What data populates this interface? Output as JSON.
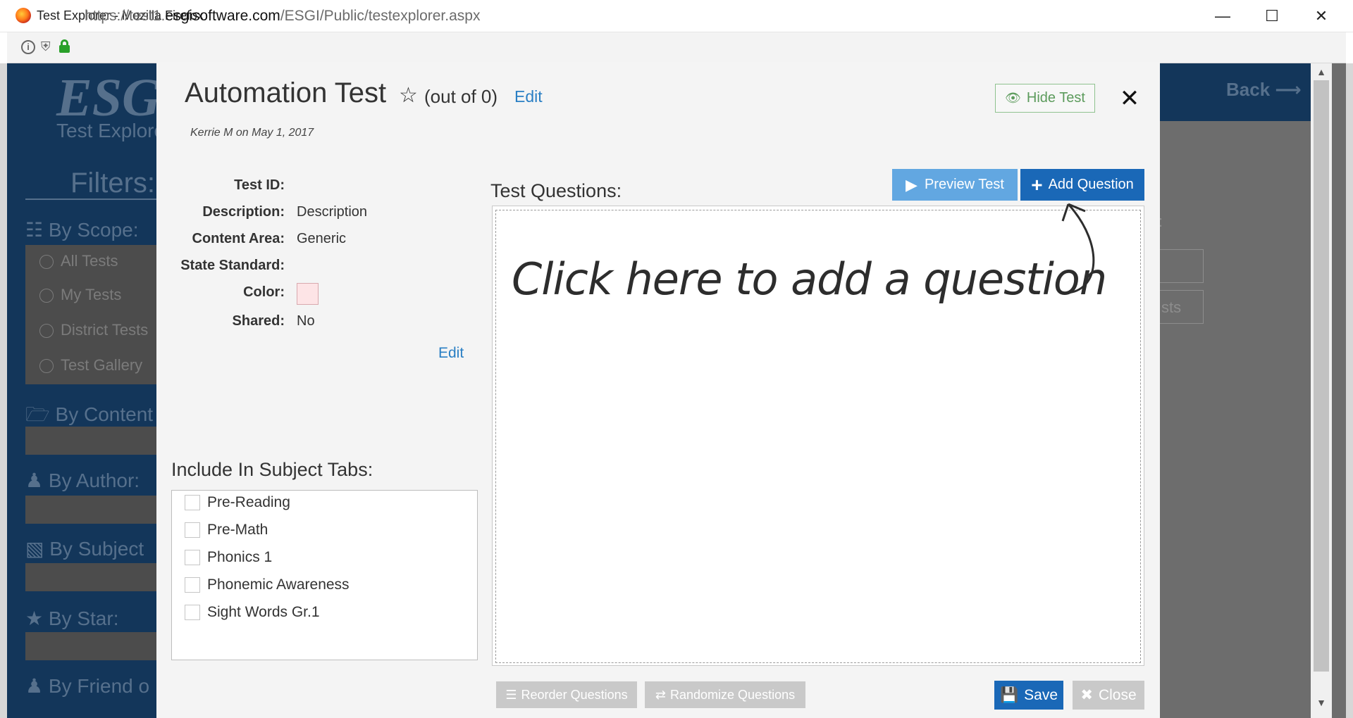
{
  "window": {
    "title": "Test Explorer - Mozilla Firefox",
    "url_prefix": "https://test1.",
    "url_domain": "esgisoftware.com",
    "url_path": "/ESGI/Public/testexplorer.aspx",
    "minimize_icon": "minimize-icon",
    "maximize_icon": "maximize-icon",
    "close_icon": "close-icon"
  },
  "background": {
    "logo": "ESGI",
    "subtitle": "Test Explorer",
    "filters_label": "Filters:",
    "back_label": "Back ⟶",
    "scope_header": "By Scope:",
    "scope_options": [
      "All Tests",
      "My Tests",
      "District Tests",
      "Test Gallery"
    ],
    "content_header": "By Content",
    "author_header": "By Author:",
    "subject_header": "By Subject",
    "star_header": "By Star:",
    "friend_header": "By Friend o",
    "right_fragment": "sts",
    "right_q": ":"
  },
  "modal": {
    "title": "Automation Test",
    "out_of": "(out of 0)",
    "edit_label": "Edit",
    "author_line": "Kerrie M on May 1, 2017",
    "hide_test_label": "Hide Test",
    "close_symbol": "✕",
    "info": {
      "test_id_label": "Test ID:",
      "test_id_value": "",
      "description_label": "Description:",
      "description_value": "Description",
      "content_area_label": "Content Area:",
      "content_area_value": "Generic",
      "state_standard_label": "State Standard:",
      "state_standard_value": "",
      "color_label": "Color:",
      "color_value": "#fde4e6",
      "shared_label": "Shared:",
      "shared_value": "No",
      "edit_label": "Edit"
    },
    "test_questions_label": "Test Questions:",
    "preview_test_label": "Preview Test",
    "add_question_label": "Add Question",
    "click_here_text": "Click here to add a question",
    "subject_tabs_label": "Include In Subject Tabs:",
    "subject_tabs": [
      "Pre-Reading",
      "Pre-Math",
      "Phonics 1",
      "Phonemic Awareness",
      "Sight Words Gr.1"
    ],
    "reorder_label": "Reorder Questions",
    "randomize_label": "Randomize Questions",
    "save_label": "Save",
    "close_label": "Close"
  },
  "colors": {
    "primary": "#1a68b7",
    "preview": "#62a7e1",
    "link": "#2a7fc4",
    "hide_green": "#5c9b5c",
    "esg_navy": "#13365a"
  }
}
